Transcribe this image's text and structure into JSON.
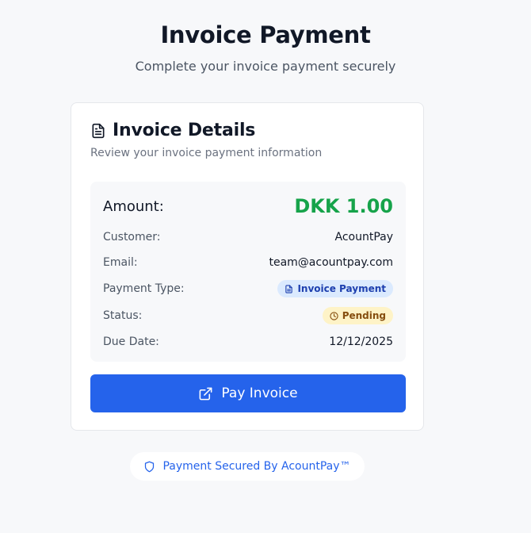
{
  "page": {
    "title": "Invoice Payment",
    "subtitle": "Complete your invoice payment securely"
  },
  "card": {
    "icon": "document-icon",
    "title": "Invoice Details",
    "description": "Review your invoice payment information"
  },
  "details": {
    "amount_label": "Amount:",
    "amount_value": "DKK 1.00",
    "customer_label": "Customer:",
    "customer_value": "AcountPay",
    "email_label": "Email:",
    "email_value": "team@acountpay.com",
    "payment_type_label": "Payment Type:",
    "payment_type_value": "Invoice Payment",
    "status_label": "Status:",
    "status_value": "Pending",
    "due_date_label": "Due Date:",
    "due_date_value": "12/12/2025"
  },
  "actions": {
    "pay_label": "Pay Invoice",
    "pay_icon": "external-link-icon"
  },
  "footer": {
    "secure_label": "Payment Secured By AcountPay™",
    "secure_icon": "shield-icon"
  },
  "colors": {
    "primary": "#2563eb",
    "amount": "#16a34a",
    "badge_type_bg": "#dbeafe",
    "badge_status_bg": "#fef3c7"
  }
}
